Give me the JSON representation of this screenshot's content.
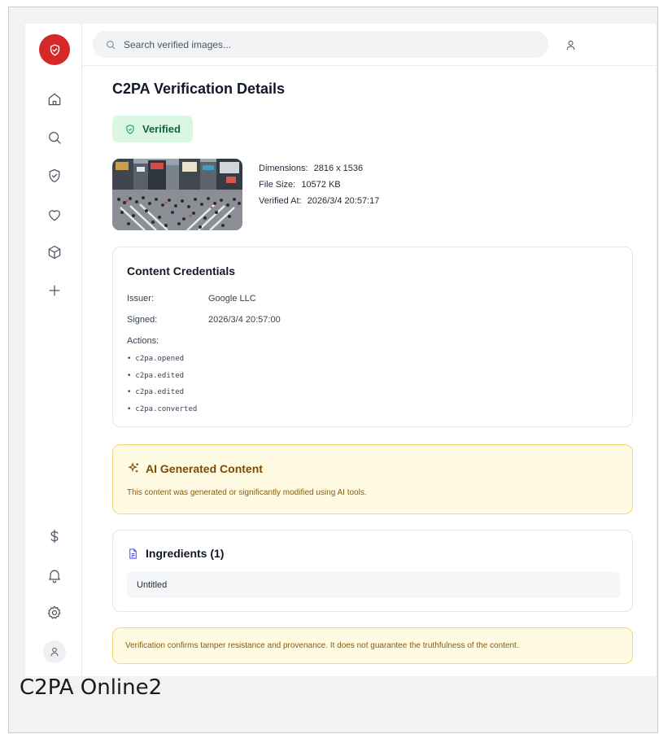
{
  "search": {
    "placeholder": "Search verified images..."
  },
  "page": {
    "title": "C2PA Verification Details"
  },
  "status": {
    "label": "Verified",
    "color": "#16a34a"
  },
  "image_info": {
    "dimensions_label": "Dimensions:",
    "dimensions": "2816 x 1536",
    "size_label": "File Size:",
    "size": "10572 KB",
    "verified_at_label": "Verified At:",
    "verified_at": "2026/3/4 20:57:17"
  },
  "credentials": {
    "title": "Content Credentials",
    "issuer_label": "Issuer:",
    "issuer": "Google LLC",
    "signed_label": "Signed:",
    "signed": "2026/3/4 20:57:00",
    "actions_label": "Actions:",
    "actions": [
      "c2pa.opened",
      "c2pa.edited",
      "c2pa.edited",
      "c2pa.converted"
    ]
  },
  "ai_notice": {
    "title": "AI Generated Content",
    "text": "This content was generated or significantly modified using AI tools."
  },
  "ingredients": {
    "title": "Ingredients (1)",
    "items": [
      "Untitled"
    ]
  },
  "disclaimer": "Verification confirms tamper resistance and provenance. It does not guarantee the truthfulness of the content.",
  "caption": "C2PA Online2",
  "colors": {
    "brand": "#d62828",
    "verified_bg": "#dcf6e4",
    "warning_bg": "#fffbe3",
    "warning_border": "#f5d76e"
  },
  "icons": {
    "sidebar": [
      "home-icon",
      "search-icon",
      "shield-check-icon",
      "heart-icon",
      "package-icon",
      "plus-icon",
      "dollar-icon",
      "bell-icon",
      "gear-icon",
      "user-icon"
    ]
  }
}
